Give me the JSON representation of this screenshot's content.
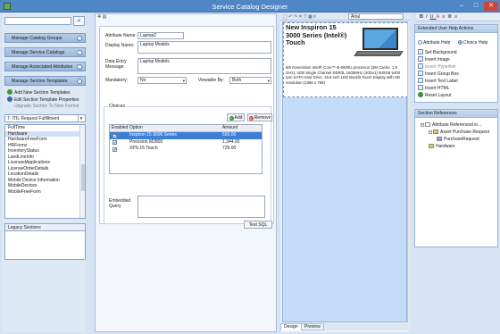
{
  "window": {
    "title": "Service Catalog Designer",
    "min": "–",
    "max": "□",
    "close": "✕"
  },
  "left": {
    "search_placeholder": "",
    "search_icon": "search-icon",
    "nav": [
      "Manage Catalog Groups",
      "Manage Service Catalogs",
      "Manage Associated Attributes",
      "Manage Section Templates"
    ],
    "actions": [
      {
        "label": "Add New Section Templates",
        "color": "#3a9b36",
        "disabled": false
      },
      {
        "label": "Edit Section Template Properties",
        "color": "#3a67b8",
        "disabled": false
      },
      {
        "label": "Upgrade Section To New Format",
        "color": "",
        "disabled": true
      }
    ],
    "filter": "7. ITIL Request Fulfillment",
    "list": [
      "FullTime",
      "Hardware",
      "HardwareFreeForm",
      "HRForms",
      "InventoryStatus",
      "LandLineInfo",
      "LicensedApplications",
      "LicenseOrderDetails",
      "LocationDetails",
      "Mobile Device Information",
      "MobileDevices",
      "MobileFreeForm"
    ],
    "list_selected": 1,
    "legacy_title": "Legacy Sections"
  },
  "editor": {
    "fields": {
      "attribute_name_label": "Attribute Name:",
      "attribute_name": "Laptop2",
      "display_name_label": "Display Name:",
      "display_name": "Laptop Models",
      "data_entry_label": "Data Entry Message:",
      "data_entry": "Laptop Models",
      "mandatory_label": "Mandatory:",
      "mandatory": "No",
      "viewable_label": "Viewable By:",
      "viewable": "Both"
    },
    "choices_title": "Choices",
    "add_label": "Add",
    "remove_label": "Remove",
    "columns": [
      "Enabled",
      "Option",
      "Amount"
    ],
    "rows": [
      {
        "enabled": true,
        "option": "Inspiron 15  3000 Series",
        "amount": "550.00",
        "selected": true
      },
      {
        "enabled": true,
        "option": "Precision M2800",
        "amount": "1,344.00",
        "selected": false
      },
      {
        "enabled": true,
        "option": "XPS 15 Touch",
        "amount": "729.00",
        "selected": false
      }
    ],
    "embedded_label": "Embedded Query",
    "test_sql_label": "Test SQL"
  },
  "designer": {
    "font": "Arial",
    "product_title": "New Inspiron 15 3000 Series (Intel®) Touch",
    "product_desc": "6th Generation Intel® Core™ i5-6500U processor (3M Cache, 1.9 GHz), 4GB Single Channel DDR3L 1600MHz (4Gbx1) 500GB 5400 rpm SATA Hard Drive, 15.6 inch LED Backlit Touch Display with HD resolution (1366 x 768)",
    "tabs": [
      "Design",
      "Preview"
    ],
    "active_tab": 0
  },
  "right": {
    "ext_title": "Extended User Help Actions",
    "radio_options": [
      "Attribute Help",
      "Choice Help"
    ],
    "radio_selected": 1,
    "ext_items": [
      {
        "label": "Set Background",
        "disabled": false
      },
      {
        "label": "Insert Image",
        "disabled": false
      },
      {
        "label": "Insert Hyperlink",
        "disabled": true
      },
      {
        "label": "Insert Group Box",
        "disabled": false
      },
      {
        "label": "Insert Text Label",
        "disabled": false
      },
      {
        "label": "Insert HTML",
        "disabled": false
      },
      {
        "label": "Reset Layout",
        "disabled": false
      }
    ],
    "refs_title": "Section References",
    "tree": [
      {
        "label": "Attribute Referenced in...",
        "depth": 0,
        "icon": "search-icon"
      },
      {
        "label": "Asset Purchase Request",
        "depth": 1,
        "icon": "folder-icon"
      },
      {
        "label": "PurchaseRequest",
        "depth": 2,
        "icon": "form-icon"
      },
      {
        "label": "Hardware",
        "depth": 1,
        "icon": "section-icon"
      }
    ]
  },
  "colors": {
    "accent": "#4f86c6",
    "selected_row": "#3d7fd6",
    "canvas": "#c4dbf7"
  }
}
